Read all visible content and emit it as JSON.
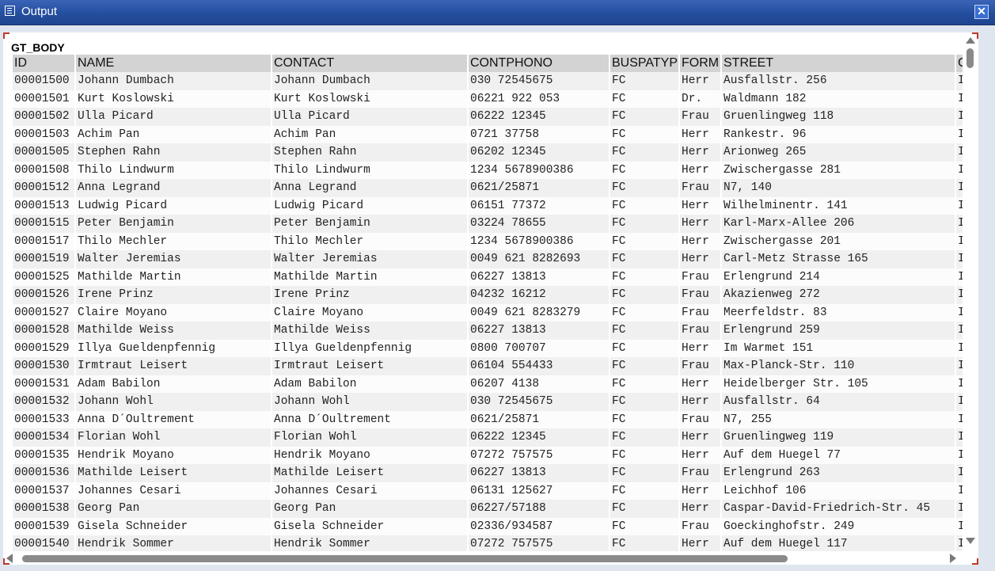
{
  "window": {
    "title": "Output",
    "close_label": "✕"
  },
  "grid": {
    "label": "GT_BODY",
    "columns": [
      "ID",
      "NAME",
      "CONTACT",
      "CONTPHONO",
      "BUSPATYP",
      "FORM",
      "STREET",
      "C"
    ],
    "rows": [
      [
        "00001500",
        "Johann Dumbach",
        "Johann Dumbach",
        "030 72545675",
        "FC",
        "Herr",
        "Ausfallstr. 256",
        "I"
      ],
      [
        "00001501",
        "Kurt Koslowski",
        "Kurt Koslowski",
        "06221 922 053",
        "FC",
        "Dr.",
        "Waldmann 182",
        "I"
      ],
      [
        "00001502",
        "Ulla Picard",
        "Ulla Picard",
        "06222 12345",
        "FC",
        "Frau",
        "Gruenlingweg 118",
        "I"
      ],
      [
        "00001503",
        "Achim Pan",
        "Achim Pan",
        "0721 37758",
        "FC",
        "Herr",
        "Rankestr. 96",
        "I"
      ],
      [
        "00001505",
        "Stephen Rahn",
        "Stephen Rahn",
        "06202 12345",
        "FC",
        "Herr",
        "Arionweg 265",
        "I"
      ],
      [
        "00001508",
        "Thilo Lindwurm",
        "Thilo Lindwurm",
        "1234 5678900386",
        "FC",
        "Herr",
        "Zwischergasse 281",
        "I"
      ],
      [
        "00001512",
        "Anna Legrand",
        "Anna Legrand",
        "0621/25871",
        "FC",
        "Frau",
        "N7, 140",
        "I"
      ],
      [
        "00001513",
        "Ludwig Picard",
        "Ludwig Picard",
        "06151 77372",
        "FC",
        "Herr",
        "Wilhelminentr. 141",
        "I"
      ],
      [
        "00001515",
        "Peter Benjamin",
        "Peter Benjamin",
        "03224 78655",
        "FC",
        "Herr",
        "Karl-Marx-Allee 206",
        "I"
      ],
      [
        "00001517",
        "Thilo Mechler",
        "Thilo Mechler",
        "1234 5678900386",
        "FC",
        "Herr",
        "Zwischergasse 201",
        "I"
      ],
      [
        "00001519",
        "Walter Jeremias",
        "Walter Jeremias",
        "0049 621 8282693",
        "FC",
        "Herr",
        "Carl-Metz Strasse 165",
        "I"
      ],
      [
        "00001525",
        "Mathilde Martin",
        "Mathilde Martin",
        "06227 13813",
        "FC",
        "Frau",
        "Erlengrund 214",
        "I"
      ],
      [
        "00001526",
        "Irene Prinz",
        "Irene Prinz",
        "04232 16212",
        "FC",
        "Frau",
        "Akazienweg 272",
        "I"
      ],
      [
        "00001527",
        "Claire Moyano",
        "Claire Moyano",
        "0049 621 8283279",
        "FC",
        "Frau",
        "Meerfeldstr. 83",
        "I"
      ],
      [
        "00001528",
        "Mathilde Weiss",
        "Mathilde Weiss",
        "06227 13813",
        "FC",
        "Frau",
        "Erlengrund 259",
        "I"
      ],
      [
        "00001529",
        "Illya Gueldenpfennig",
        "Illya Gueldenpfennig",
        "0800 700707",
        "FC",
        "Herr",
        "Im Warmet 151",
        "I"
      ],
      [
        "00001530",
        "Irmtraut Leisert",
        "Irmtraut Leisert",
        "06104 554433",
        "FC",
        "Frau",
        "Max-Planck-Str. 110",
        "I"
      ],
      [
        "00001531",
        "Adam Babilon",
        "Adam Babilon",
        "06207 4138",
        "FC",
        "Herr",
        "Heidelberger Str. 105",
        "I"
      ],
      [
        "00001532",
        "Johann Wohl",
        "Johann Wohl",
        "030 72545675",
        "FC",
        "Herr",
        "Ausfallstr. 64",
        "I"
      ],
      [
        "00001533",
        "Anna D´Oultrement",
        "Anna D´Oultrement",
        "0621/25871",
        "FC",
        "Frau",
        "N7, 255",
        "I"
      ],
      [
        "00001534",
        "Florian Wohl",
        "Florian Wohl",
        "06222 12345",
        "FC",
        "Herr",
        "Gruenlingweg 119",
        "I"
      ],
      [
        "00001535",
        "Hendrik Moyano",
        "Hendrik Moyano",
        "07272 757575",
        "FC",
        "Herr",
        "Auf dem Huegel 77",
        "I"
      ],
      [
        "00001536",
        "Mathilde Leisert",
        "Mathilde Leisert",
        "06227 13813",
        "FC",
        "Frau",
        "Erlengrund 263",
        "I"
      ],
      [
        "00001537",
        "Johannes Cesari",
        "Johannes Cesari",
        "06131 125627",
        "FC",
        "Herr",
        "Leichhof 106",
        "I"
      ],
      [
        "00001538",
        "Georg Pan",
        "Georg Pan",
        "06227/57188",
        "FC",
        "Herr",
        "Caspar-David-Friedrich-Str. 45",
        "I"
      ],
      [
        "00001539",
        "Gisela Schneider",
        "Gisela Schneider",
        "02336/934587",
        "FC",
        "Frau",
        "Goeckinghofstr. 249",
        "I"
      ],
      [
        "00001540",
        "Hendrik Sommer",
        "Hendrik Sommer",
        "07272 757575",
        "FC",
        "Herr",
        "Auf dem Huegel 117",
        "I"
      ]
    ]
  },
  "icons": {
    "title": "list-window-icon",
    "close": "close-icon",
    "scroll_up": "arrow-up-icon",
    "scroll_down": "arrow-down-icon",
    "scroll_left": "arrow-left-icon",
    "scroll_right": "arrow-right-icon"
  },
  "colors": {
    "titlebar": "#244e9e",
    "header_bg": "#d3d3d3",
    "corner_marks": "#c0392b"
  }
}
